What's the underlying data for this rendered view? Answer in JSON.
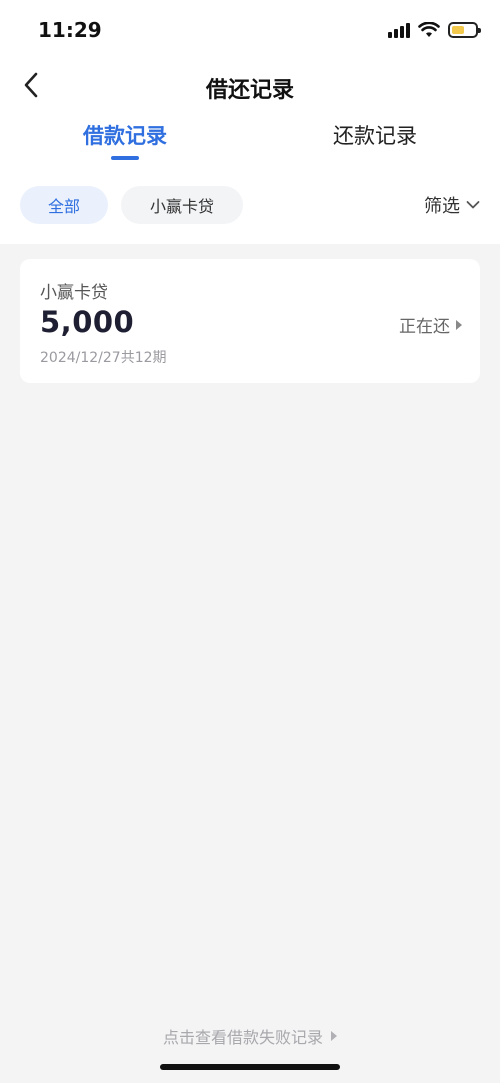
{
  "status_bar": {
    "time": "11:29"
  },
  "nav": {
    "title": "借还记录",
    "back_icon": "chevron-left-icon"
  },
  "tabs": [
    {
      "label": "借款记录",
      "active": true
    },
    {
      "label": "还款记录",
      "active": false
    }
  ],
  "filters": {
    "chips": [
      {
        "label": "全部",
        "selected": true
      },
      {
        "label": "小赢卡贷",
        "selected": false
      }
    ],
    "filter_label": "筛选",
    "filter_icon": "chevron-down-icon"
  },
  "loans": [
    {
      "product": "小赢卡贷",
      "amount": "5,000",
      "meta": "2024/12/27共12期",
      "status": "正在还"
    }
  ],
  "footer": {
    "failed_link": "点击查看借款失败记录"
  },
  "colors": {
    "accent": "#2f6fdf",
    "background": "#f4f4f5",
    "battery": "#f2c94c"
  }
}
